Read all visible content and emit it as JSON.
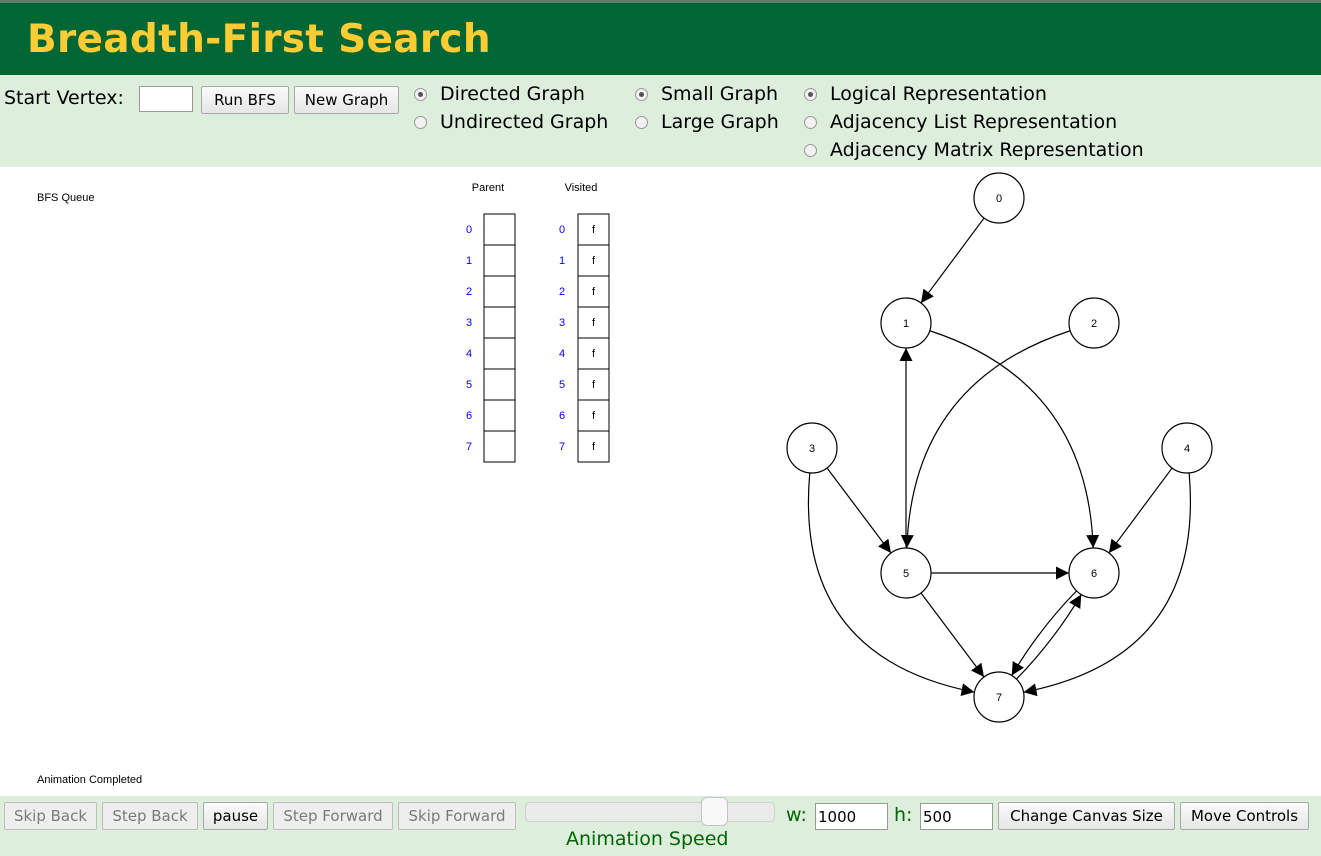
{
  "header": {
    "title": "Breadth-First Search"
  },
  "controls": {
    "start_vertex_label": "Start Vertex:",
    "start_vertex_value": "",
    "run_button": "Run BFS",
    "new_graph_button": "New Graph",
    "graph_direction": [
      {
        "label": "Directed Graph",
        "checked": true
      },
      {
        "label": "Undirected Graph",
        "checked": false
      }
    ],
    "graph_size": [
      {
        "label": "Small Graph",
        "checked": true
      },
      {
        "label": "Large Graph",
        "checked": false
      }
    ],
    "representation": [
      {
        "label": "Logical Representation",
        "checked": true
      },
      {
        "label": "Adjacency List Representation",
        "checked": false
      },
      {
        "label": "Adjacency Matrix Representation",
        "checked": false
      }
    ]
  },
  "canvas": {
    "queue_label": "BFS Queue",
    "parent_header": "Parent",
    "visited_header": "Visited",
    "indices": [
      "0",
      "1",
      "2",
      "3",
      "4",
      "5",
      "6",
      "7"
    ],
    "parent_values": [
      "",
      "",
      "",
      "",
      "",
      "",
      "",
      ""
    ],
    "visited_values": [
      "f",
      "f",
      "f",
      "f",
      "f",
      "f",
      "f",
      "f"
    ],
    "status": "Animation Completed",
    "graph": {
      "vertices": [
        "0",
        "1",
        "2",
        "3",
        "4",
        "5",
        "6",
        "7"
      ],
      "edges": [
        [
          0,
          1
        ],
        [
          1,
          6
        ],
        [
          2,
          5
        ],
        [
          3,
          5
        ],
        [
          3,
          7
        ],
        [
          4,
          6
        ],
        [
          4,
          7
        ],
        [
          5,
          1
        ],
        [
          5,
          6
        ],
        [
          5,
          7
        ],
        [
          7,
          6
        ],
        [
          6,
          7
        ]
      ]
    }
  },
  "bottom": {
    "skip_back": "Skip Back",
    "step_back": "Step Back",
    "pause": "pause",
    "step_forward": "Step Forward",
    "skip_forward": "Skip Forward",
    "speed_label": "Animation Speed",
    "speed_fraction": 0.75,
    "w_label": "w:",
    "w_value": "1000",
    "h_label": "h:",
    "h_value": "500",
    "change_canvas_button": "Change Canvas Size",
    "move_controls_button": "Move Controls"
  }
}
